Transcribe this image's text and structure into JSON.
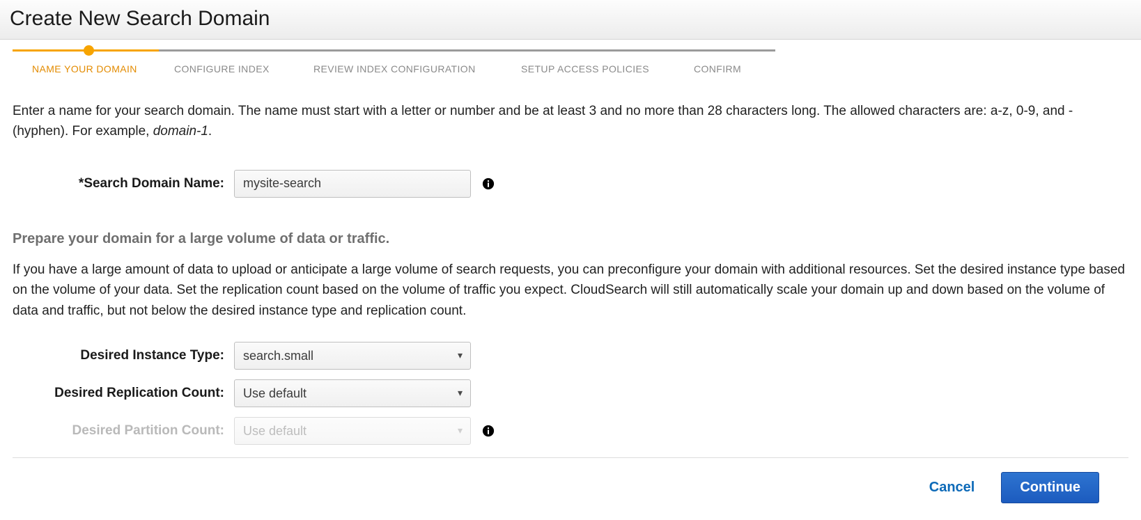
{
  "header": {
    "title": "Create New Search Domain"
  },
  "stepper": {
    "steps": [
      {
        "label": "NAME YOUR DOMAIN",
        "active": true
      },
      {
        "label": "CONFIGURE INDEX",
        "active": false
      },
      {
        "label": "REVIEW INDEX CONFIGURATION",
        "active": false
      },
      {
        "label": "SETUP ACCESS POLICIES",
        "active": false
      },
      {
        "label": "CONFIRM",
        "active": false
      }
    ]
  },
  "intro": {
    "text_before_example": "Enter a name for your search domain. The name must start with a letter or number and be at least 3 and no more than 28 characters long. The allowed characters are: a-z, 0-9, and - (hyphen). For example, ",
    "example": "domain-1",
    "text_after_example": "."
  },
  "form": {
    "domain_name": {
      "label": "*Search Domain Name:",
      "value": "mysite-search"
    },
    "scaling": {
      "heading": "Prepare your domain for a large volume of data or traffic.",
      "body": "If you have a large amount of data to upload or anticipate a large volume of search requests, you can preconfigure your domain with additional resources. Set the desired instance type based on the volume of your data. Set the replication count based on the volume of traffic you expect. CloudSearch will still automatically scale your domain up and down based on the volume of data and traffic, but not below the desired instance type and replication count.",
      "instance_type": {
        "label": "Desired Instance Type:",
        "value": "search.small"
      },
      "replication_count": {
        "label": "Desired Replication Count:",
        "value": "Use default"
      },
      "partition_count": {
        "label": "Desired Partition Count:",
        "value": "Use default",
        "disabled": true
      }
    }
  },
  "footer": {
    "cancel": "Cancel",
    "continue": "Continue"
  }
}
